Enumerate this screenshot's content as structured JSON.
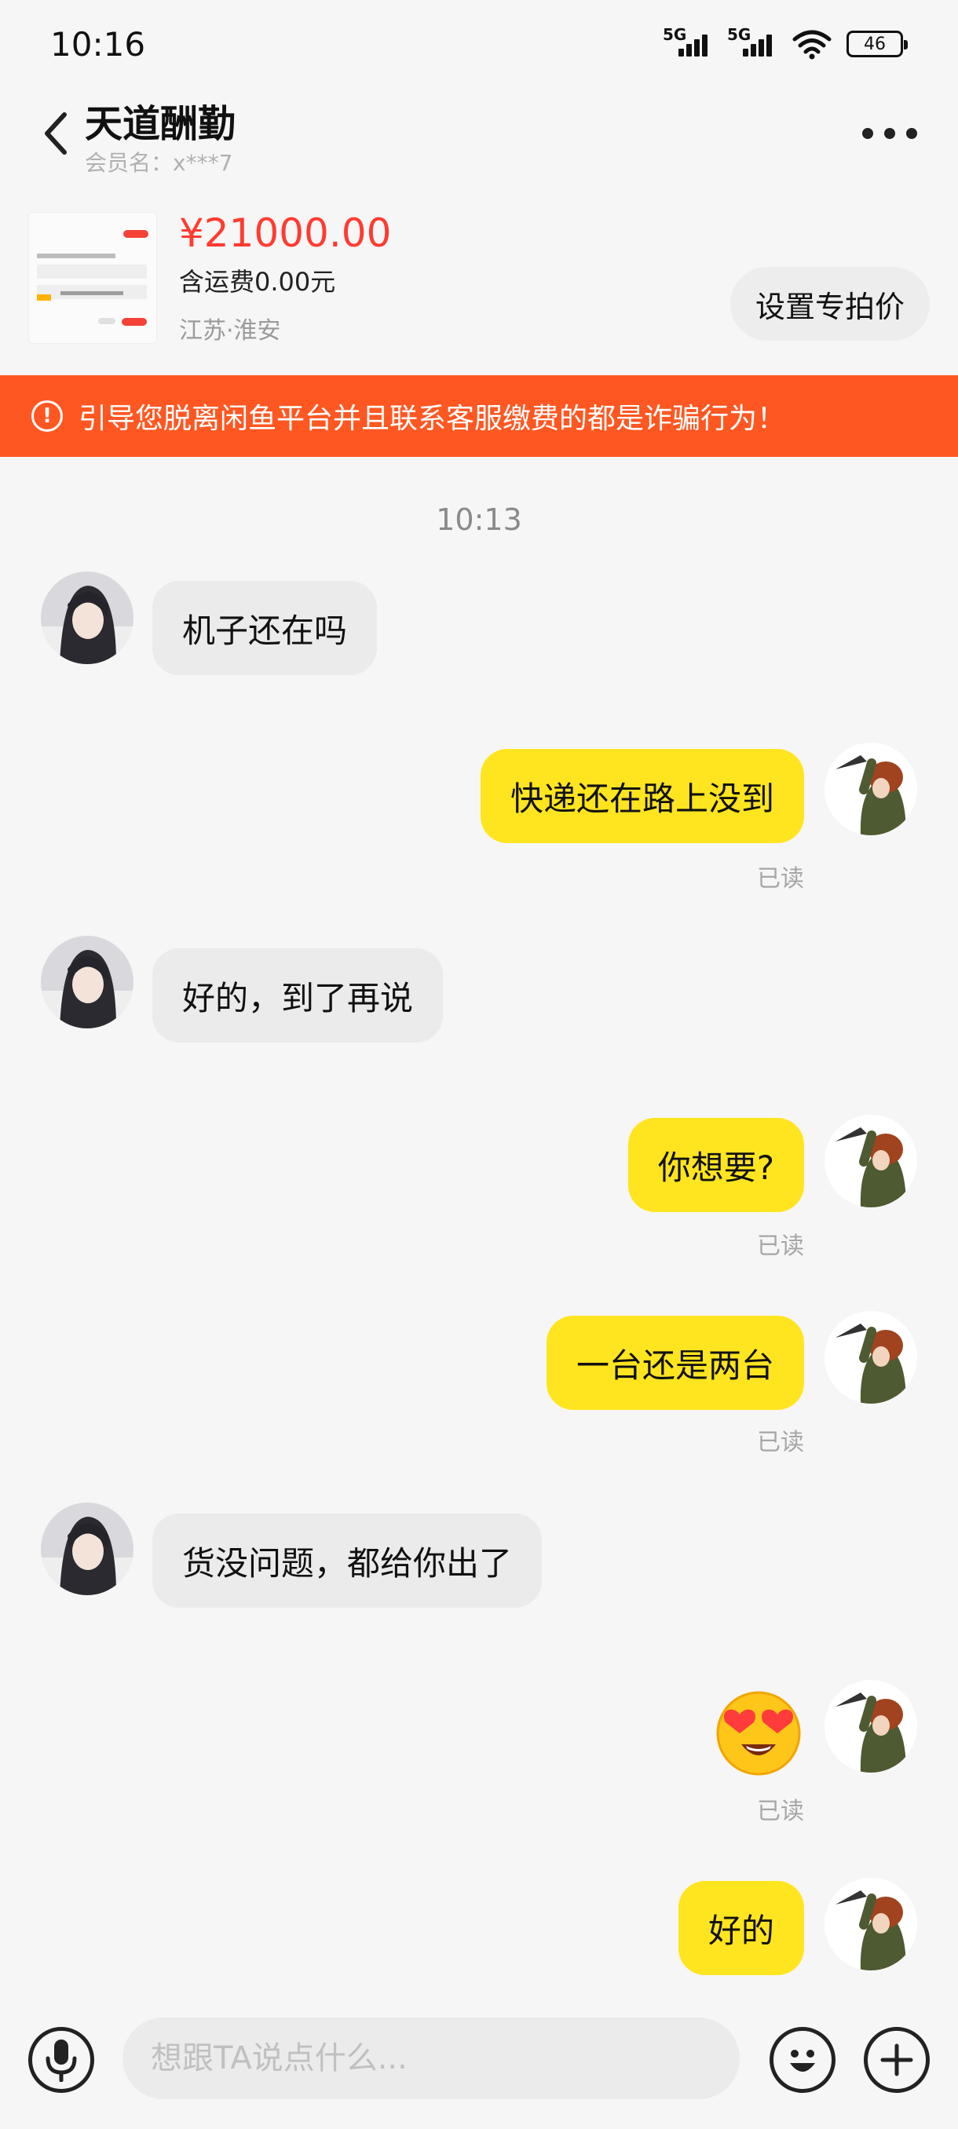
{
  "status_bar": {
    "time": "10:16",
    "sig1": "5G",
    "sig2": "5G",
    "battery": "46"
  },
  "header": {
    "title": "天道酬勤",
    "member_label": "会员名：x***7"
  },
  "product": {
    "price": "¥21000.00",
    "shipping": "含运费0.00元",
    "location": "江苏·淮安",
    "special_price_button": "设置专拍价"
  },
  "warning": {
    "icon": "exclamation-circle-icon",
    "text": "引导您脱离闲鱼平台并且联系客服缴费的都是诈骗行为！"
  },
  "chat": {
    "time": "10:13",
    "messages": [
      {
        "from": "them",
        "text": "机子还在吗"
      },
      {
        "from": "me",
        "text": "快递还在路上没到",
        "status": "已读"
      },
      {
        "from": "them",
        "text": "好的，到了再说"
      },
      {
        "from": "me",
        "text": "你想要?",
        "status": "已读"
      },
      {
        "from": "me",
        "text": "一台还是两台",
        "status": "已读"
      },
      {
        "from": "them",
        "text": "货没问题，都给你出了"
      },
      {
        "from": "me",
        "emoji": "heart-eyes-emoji",
        "status": "已读"
      },
      {
        "from": "me",
        "text": "好的"
      }
    ]
  },
  "input_bar": {
    "placeholder": "想跟TA说点什么...",
    "voice_icon": "microphone-icon",
    "emoji_icon": "smiley-icon",
    "plus_icon": "plus-icon"
  },
  "colors": {
    "accent_yellow": "#ffe51f",
    "warning_orange": "#ff5722",
    "price_red": "#ff3b30"
  }
}
